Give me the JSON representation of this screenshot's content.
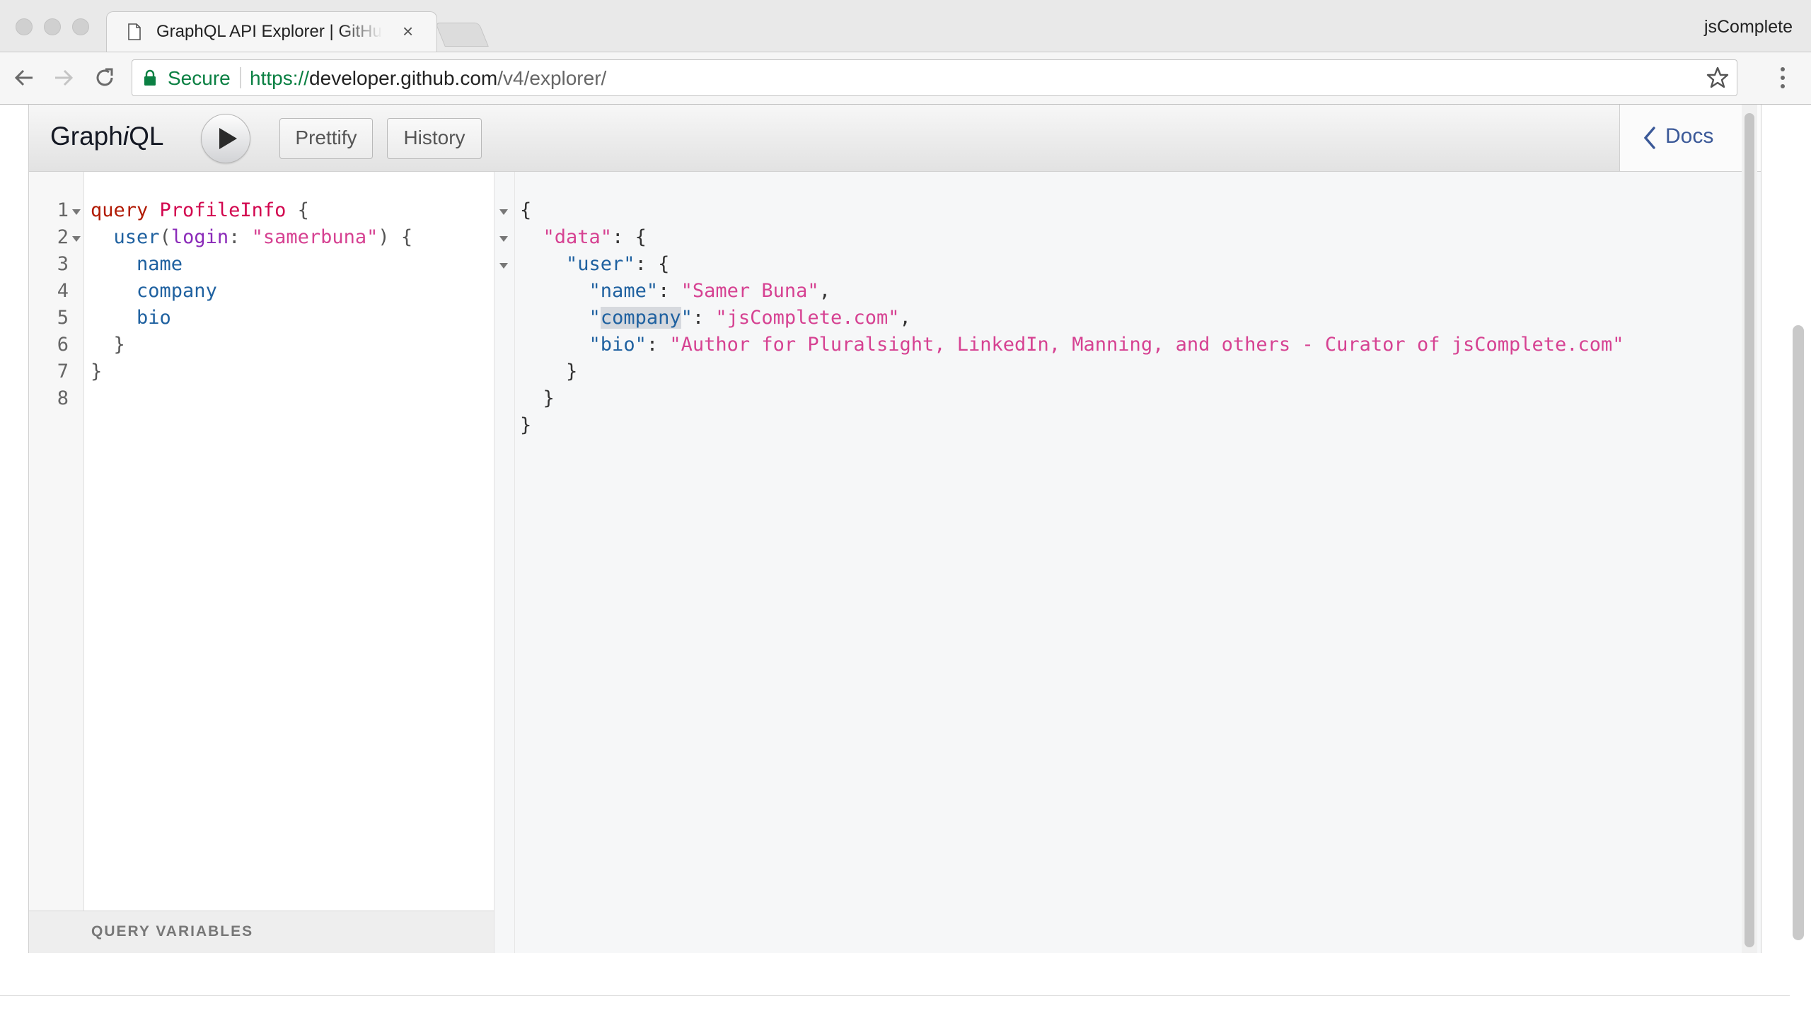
{
  "browser": {
    "tab_title": "GraphQL API Explorer | GitHub",
    "profile_name": "jsComplete",
    "secure_label": "Secure",
    "url_scheme": "https://",
    "url_host": "developer.github.com",
    "url_path": "/v4/explorer/"
  },
  "graphiql": {
    "title_prefix": "Graph",
    "title_italic": "i",
    "title_suffix": "QL",
    "prettify_label": "Prettify",
    "history_label": "History",
    "docs_label": "Docs",
    "query_variables_label": "QUERY VARIABLES",
    "line_numbers": [
      "1",
      "2",
      "3",
      "4",
      "5",
      "6",
      "7",
      "8"
    ],
    "query": {
      "l1_kw": "query",
      "l1_name": "ProfileInfo",
      "l1_brace": "{",
      "l2_field": "user",
      "l2_open": "(",
      "l2_arg": "login",
      "l2_colon": ": ",
      "l2_value": "\"samerbuna\"",
      "l2_close": ") {",
      "l3_field": "name",
      "l4_field": "company",
      "l5_field": "bio",
      "l6_brace": "}",
      "l7_brace": "}"
    },
    "result": {
      "r1": "{",
      "r2_key": "\"data\"",
      "r2_rest": ": {",
      "r3_key": "\"user\"",
      "r3_rest": ": {",
      "r4_key": "\"name\"",
      "r4_sep": ": ",
      "r4_val": "\"Samer Buna\"",
      "r4_comma": ",",
      "r5_q1": "\"",
      "r5_key": "company",
      "r5_q2": "\"",
      "r5_sep": ": ",
      "r5_val": "\"jsComplete.com\"",
      "r5_comma": ",",
      "r6_key": "\"bio\"",
      "r6_sep": ": ",
      "r6_val": "\"Author for Pluralsight, LinkedIn, Manning, and others - Curator of jsComplete.com\"",
      "r7": "}",
      "r8": "}",
      "r9": "}"
    }
  },
  "colors": {
    "keyword": "#b11a04",
    "definition": "#d2054e",
    "field": "#1f61a0",
    "attribute": "#8b2bb9",
    "string": "#d64292",
    "secure_green": "#0b8043",
    "docs_link": "#3b5998"
  }
}
